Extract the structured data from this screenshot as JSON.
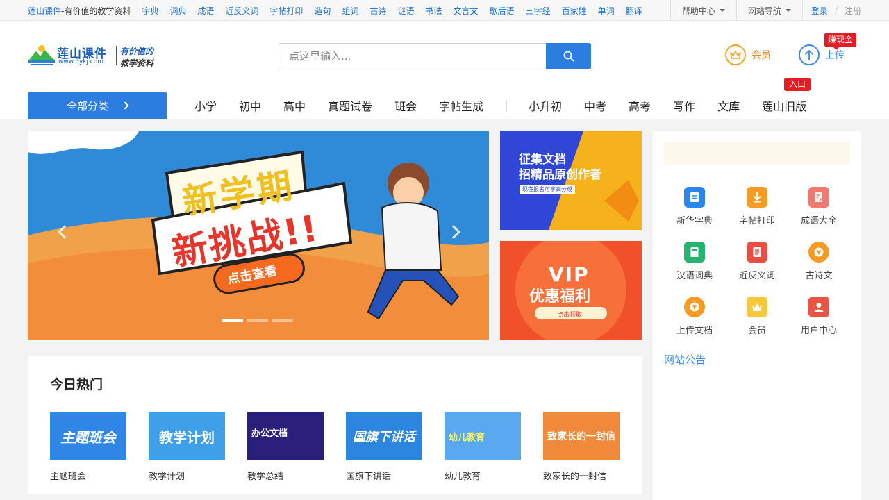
{
  "topbar": {
    "brand": "莲山课件",
    "slogan": "-有价值的教学资料",
    "links": [
      "字典",
      "词典",
      "成语",
      "近反义词",
      "字帖打印",
      "造句",
      "组词",
      "古诗",
      "谜语",
      "书法",
      "文言文",
      "歇后语",
      "三字经",
      "百家姓",
      "单词",
      "翻译"
    ],
    "help": "帮助中心",
    "site_nav": "网站导航",
    "login": "登录",
    "sep": "/",
    "register": "注册"
  },
  "header": {
    "logo_title": "莲山课件",
    "logo_url": "www.5ykj.com",
    "logo_tag1": "有价值的",
    "logo_tag2": "教学资料",
    "search_placeholder": "点这里输入...",
    "member": "会员",
    "upload": "上传",
    "earn_badge": "赚现金",
    "entry_badge": "入口",
    "all_categories": "全部分类",
    "nav_a": [
      "小学",
      "初中",
      "高中",
      "真题试卷",
      "班会",
      "字帖生成"
    ],
    "nav_b": [
      "小升初",
      "中考",
      "高考",
      "写作",
      "文库",
      "莲山旧版"
    ]
  },
  "banner": {
    "headline1": "新学期",
    "headline2": "新挑战!!",
    "cta": "点击查看",
    "slides": 3,
    "active_slide": 1
  },
  "ads": {
    "ad1_line1": "征集文档",
    "ad1_line2": "招精品原创作者",
    "ad1_tag": "现在报名可享高分成",
    "ad2_title1": "VIP",
    "ad2_title2": "优惠福利",
    "ad2_cta": "点击领取"
  },
  "hot": {
    "title": "今日热门",
    "items": [
      {
        "thumb": "主题班会",
        "caption": "主题班会",
        "color": "#2f86e6"
      },
      {
        "thumb": "教学计划",
        "caption": "教学计划",
        "color": "#3f9fe8"
      },
      {
        "thumb": "办公文档",
        "caption": "教学总结",
        "color": "#2a1f7a"
      },
      {
        "thumb": "国旗下讲话",
        "caption": "国旗下讲话",
        "color": "#2c86e0"
      },
      {
        "thumb": "幼儿教育",
        "caption": "幼儿教育",
        "color": "#5aa8f0"
      },
      {
        "thumb": "致家长的一封信",
        "caption": "致家长的一封信",
        "color": "#f08a3a"
      }
    ]
  },
  "tools": [
    {
      "label": "新华字典",
      "icon": "dictionary-icon",
      "color": "#2b86ee"
    },
    {
      "label": "字帖打印",
      "icon": "download-icon",
      "color": "#f59a22"
    },
    {
      "label": "成语大全",
      "icon": "edit-note-icon",
      "color": "#ef7a72"
    },
    {
      "label": "汉语词典",
      "icon": "book-icon",
      "color": "#27b36f"
    },
    {
      "label": "近反义词",
      "icon": "document-icon",
      "color": "#ea4d42"
    },
    {
      "label": "古诗文",
      "icon": "poem-icon",
      "color": "#f59a22"
    },
    {
      "label": "上传文档",
      "icon": "upload-doc-icon",
      "color": "#f59a22"
    },
    {
      "label": "会员",
      "icon": "crown-icon",
      "color": "#f7c73c"
    },
    {
      "label": "用户中心",
      "icon": "user-icon",
      "color": "#ea5442"
    }
  ],
  "announcement": "网站公告"
}
